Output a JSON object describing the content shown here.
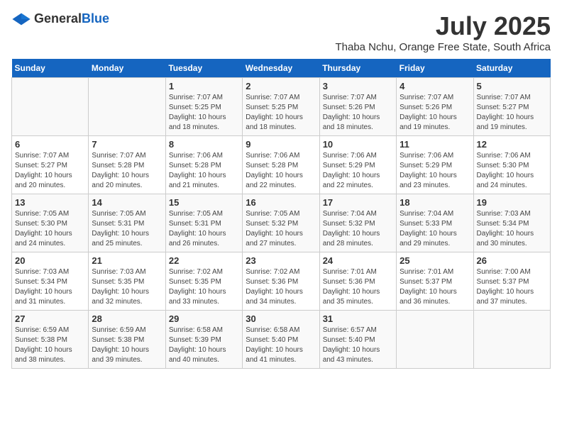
{
  "header": {
    "logo_general": "General",
    "logo_blue": "Blue",
    "title": "July 2025",
    "subtitle": "Thaba Nchu, Orange Free State, South Africa"
  },
  "calendar": {
    "days_of_week": [
      "Sunday",
      "Monday",
      "Tuesday",
      "Wednesday",
      "Thursday",
      "Friday",
      "Saturday"
    ],
    "weeks": [
      [
        {
          "day": "",
          "detail": ""
        },
        {
          "day": "",
          "detail": ""
        },
        {
          "day": "1",
          "detail": "Sunrise: 7:07 AM\nSunset: 5:25 PM\nDaylight: 10 hours\nand 18 minutes."
        },
        {
          "day": "2",
          "detail": "Sunrise: 7:07 AM\nSunset: 5:25 PM\nDaylight: 10 hours\nand 18 minutes."
        },
        {
          "day": "3",
          "detail": "Sunrise: 7:07 AM\nSunset: 5:26 PM\nDaylight: 10 hours\nand 18 minutes."
        },
        {
          "day": "4",
          "detail": "Sunrise: 7:07 AM\nSunset: 5:26 PM\nDaylight: 10 hours\nand 19 minutes."
        },
        {
          "day": "5",
          "detail": "Sunrise: 7:07 AM\nSunset: 5:27 PM\nDaylight: 10 hours\nand 19 minutes."
        }
      ],
      [
        {
          "day": "6",
          "detail": "Sunrise: 7:07 AM\nSunset: 5:27 PM\nDaylight: 10 hours\nand 20 minutes."
        },
        {
          "day": "7",
          "detail": "Sunrise: 7:07 AM\nSunset: 5:28 PM\nDaylight: 10 hours\nand 20 minutes."
        },
        {
          "day": "8",
          "detail": "Sunrise: 7:06 AM\nSunset: 5:28 PM\nDaylight: 10 hours\nand 21 minutes."
        },
        {
          "day": "9",
          "detail": "Sunrise: 7:06 AM\nSunset: 5:28 PM\nDaylight: 10 hours\nand 22 minutes."
        },
        {
          "day": "10",
          "detail": "Sunrise: 7:06 AM\nSunset: 5:29 PM\nDaylight: 10 hours\nand 22 minutes."
        },
        {
          "day": "11",
          "detail": "Sunrise: 7:06 AM\nSunset: 5:29 PM\nDaylight: 10 hours\nand 23 minutes."
        },
        {
          "day": "12",
          "detail": "Sunrise: 7:06 AM\nSunset: 5:30 PM\nDaylight: 10 hours\nand 24 minutes."
        }
      ],
      [
        {
          "day": "13",
          "detail": "Sunrise: 7:05 AM\nSunset: 5:30 PM\nDaylight: 10 hours\nand 24 minutes."
        },
        {
          "day": "14",
          "detail": "Sunrise: 7:05 AM\nSunset: 5:31 PM\nDaylight: 10 hours\nand 25 minutes."
        },
        {
          "day": "15",
          "detail": "Sunrise: 7:05 AM\nSunset: 5:31 PM\nDaylight: 10 hours\nand 26 minutes."
        },
        {
          "day": "16",
          "detail": "Sunrise: 7:05 AM\nSunset: 5:32 PM\nDaylight: 10 hours\nand 27 minutes."
        },
        {
          "day": "17",
          "detail": "Sunrise: 7:04 AM\nSunset: 5:32 PM\nDaylight: 10 hours\nand 28 minutes."
        },
        {
          "day": "18",
          "detail": "Sunrise: 7:04 AM\nSunset: 5:33 PM\nDaylight: 10 hours\nand 29 minutes."
        },
        {
          "day": "19",
          "detail": "Sunrise: 7:03 AM\nSunset: 5:34 PM\nDaylight: 10 hours\nand 30 minutes."
        }
      ],
      [
        {
          "day": "20",
          "detail": "Sunrise: 7:03 AM\nSunset: 5:34 PM\nDaylight: 10 hours\nand 31 minutes."
        },
        {
          "day": "21",
          "detail": "Sunrise: 7:03 AM\nSunset: 5:35 PM\nDaylight: 10 hours\nand 32 minutes."
        },
        {
          "day": "22",
          "detail": "Sunrise: 7:02 AM\nSunset: 5:35 PM\nDaylight: 10 hours\nand 33 minutes."
        },
        {
          "day": "23",
          "detail": "Sunrise: 7:02 AM\nSunset: 5:36 PM\nDaylight: 10 hours\nand 34 minutes."
        },
        {
          "day": "24",
          "detail": "Sunrise: 7:01 AM\nSunset: 5:36 PM\nDaylight: 10 hours\nand 35 minutes."
        },
        {
          "day": "25",
          "detail": "Sunrise: 7:01 AM\nSunset: 5:37 PM\nDaylight: 10 hours\nand 36 minutes."
        },
        {
          "day": "26",
          "detail": "Sunrise: 7:00 AM\nSunset: 5:37 PM\nDaylight: 10 hours\nand 37 minutes."
        }
      ],
      [
        {
          "day": "27",
          "detail": "Sunrise: 6:59 AM\nSunset: 5:38 PM\nDaylight: 10 hours\nand 38 minutes."
        },
        {
          "day": "28",
          "detail": "Sunrise: 6:59 AM\nSunset: 5:38 PM\nDaylight: 10 hours\nand 39 minutes."
        },
        {
          "day": "29",
          "detail": "Sunrise: 6:58 AM\nSunset: 5:39 PM\nDaylight: 10 hours\nand 40 minutes."
        },
        {
          "day": "30",
          "detail": "Sunrise: 6:58 AM\nSunset: 5:40 PM\nDaylight: 10 hours\nand 41 minutes."
        },
        {
          "day": "31",
          "detail": "Sunrise: 6:57 AM\nSunset: 5:40 PM\nDaylight: 10 hours\nand 43 minutes."
        },
        {
          "day": "",
          "detail": ""
        },
        {
          "day": "",
          "detail": ""
        }
      ]
    ]
  }
}
